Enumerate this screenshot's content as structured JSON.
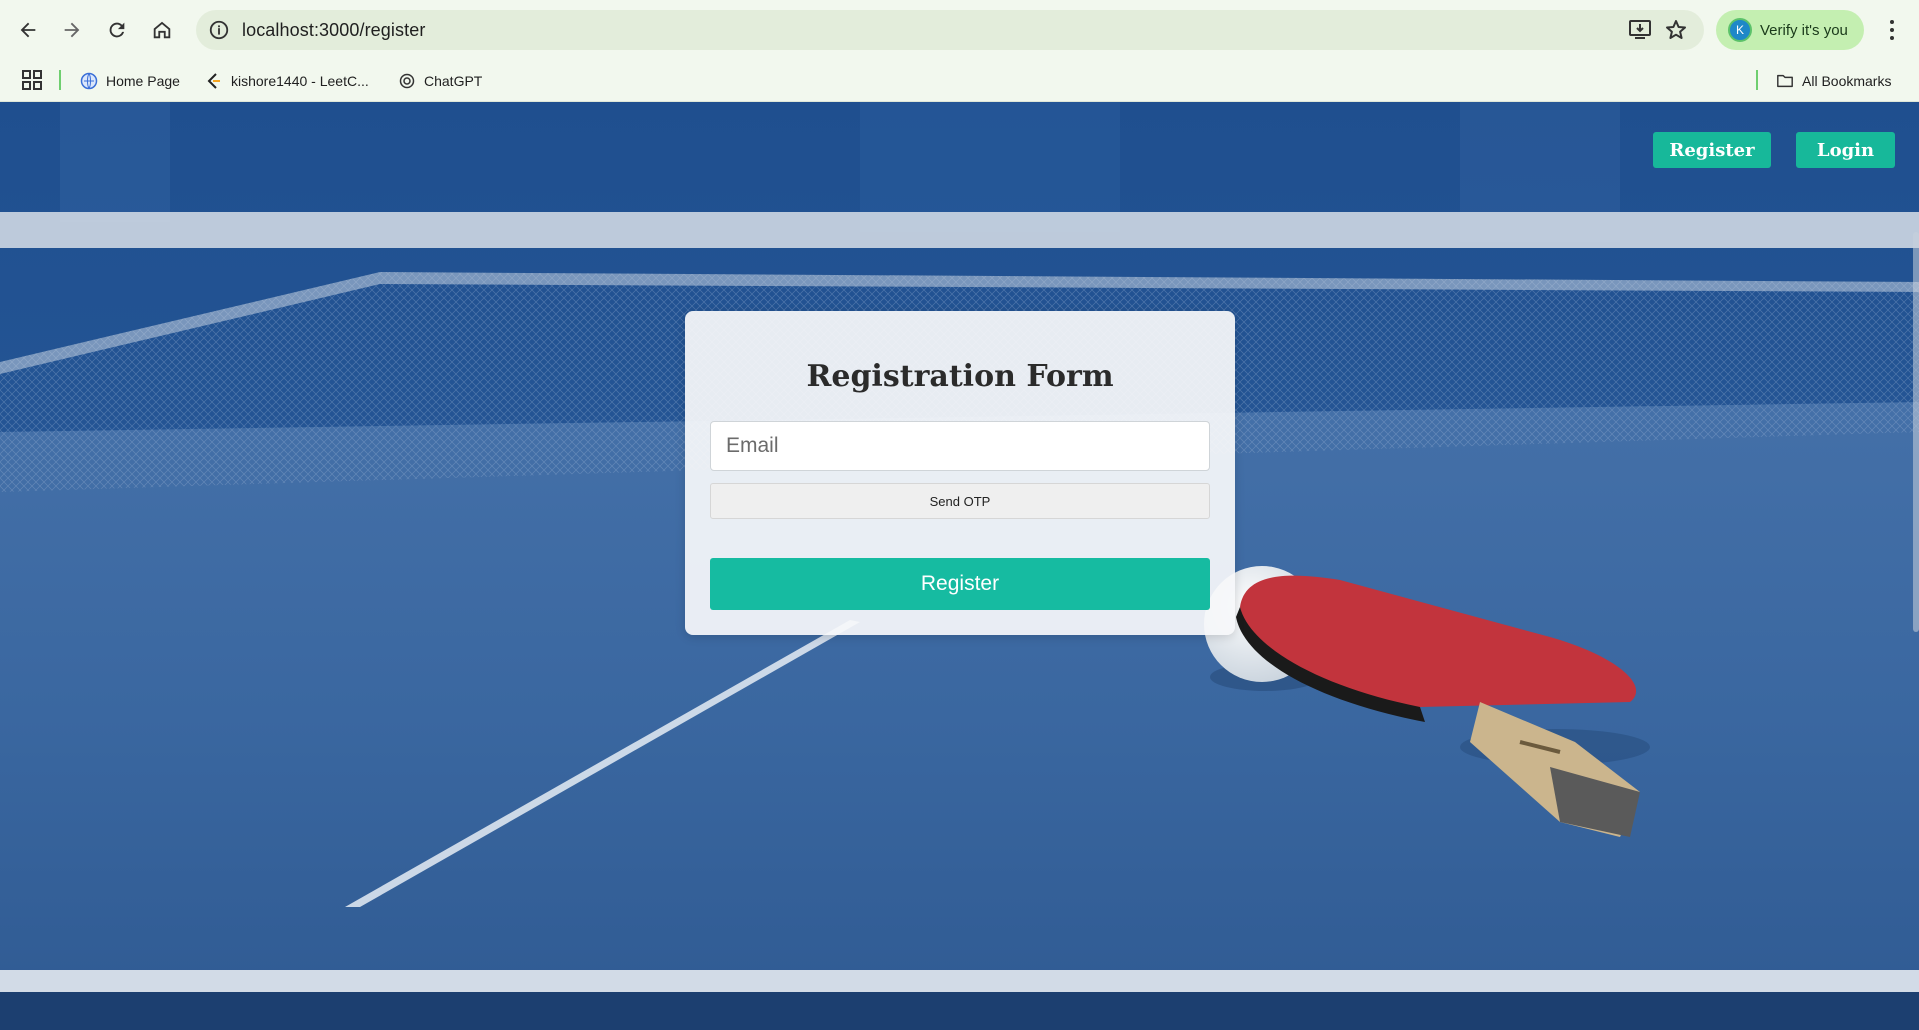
{
  "browser": {
    "url": "localhost:3000/register",
    "profile_initial": "K",
    "verify_label": "Verify it's you",
    "icons": [
      "back-arrow-icon",
      "forward-arrow-icon",
      "reload-icon",
      "home-icon",
      "site-info-icon",
      "install-app-icon",
      "star-icon",
      "kebab-menu-icon",
      "apps-grid-icon",
      "folder-icon"
    ]
  },
  "bookmarks": {
    "items": [
      {
        "label": "Home Page",
        "icon": "globe-icon"
      },
      {
        "label": "kishore1440 - LeetC...",
        "icon": "leetcode-icon"
      },
      {
        "label": "ChatGPT",
        "icon": "chatgpt-icon"
      }
    ],
    "all_bookmarks_label": "All Bookmarks"
  },
  "page": {
    "nav": {
      "register_label": "Register",
      "login_label": "Login"
    },
    "form": {
      "title": "Registration Form",
      "email_placeholder": "Email",
      "email_value": "",
      "send_otp_label": "Send OTP",
      "register_label": "Register"
    },
    "background": "table-tennis-table-with-paddle-and-ball"
  },
  "colors": {
    "accent": "#17b89a",
    "chrome_bg": "#f2f8ee",
    "omnibox_bg": "#e3eddb",
    "verify_bg": "#c4efb1",
    "table_blue": "#3d6aa3"
  }
}
